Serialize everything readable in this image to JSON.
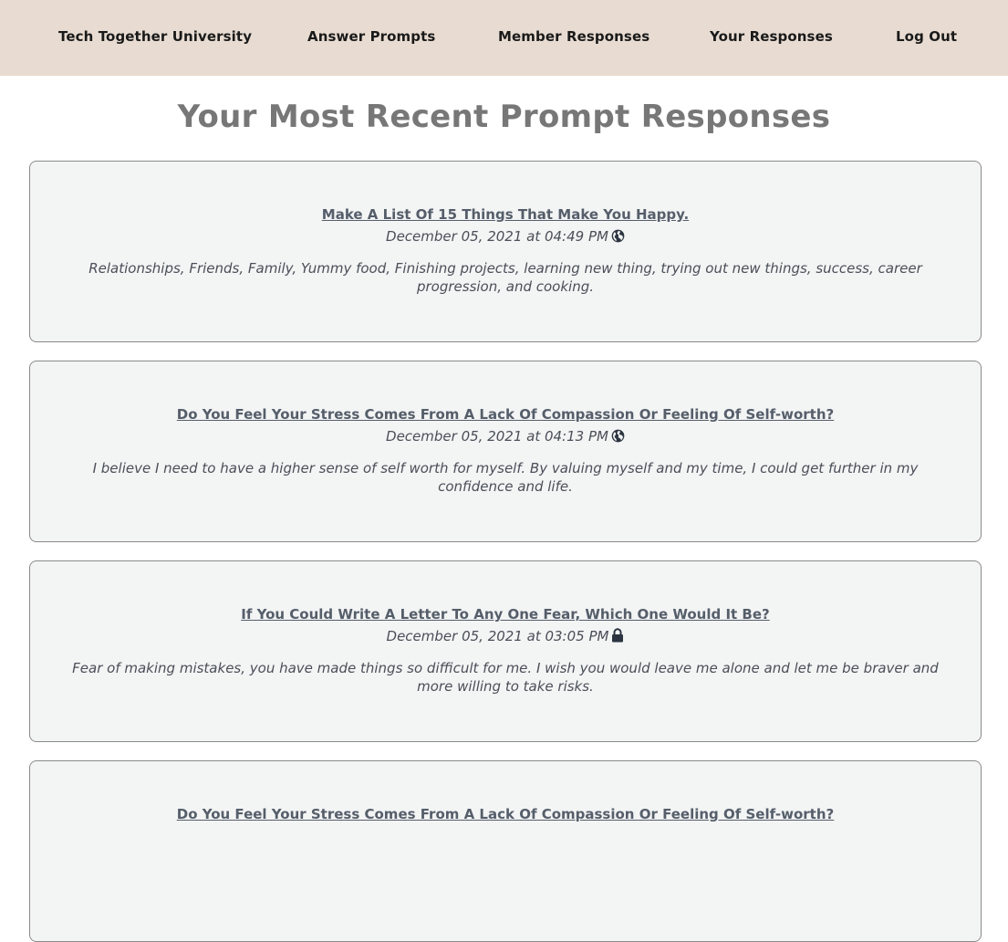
{
  "nav": {
    "items": [
      {
        "label": "Tech Together University"
      },
      {
        "label": "Answer Prompts"
      },
      {
        "label": "Member Responses"
      },
      {
        "label": "Your Responses"
      },
      {
        "label": "Log Out"
      }
    ]
  },
  "page": {
    "title": "Your Most Recent Prompt Responses"
  },
  "responses": [
    {
      "title": "Make A List Of 15 Things That Make You Happy.",
      "date": "December 05, 2021 at 04:49 PM",
      "visibility_icon": "globe-icon",
      "body": "Relationships, Friends, Family, Yummy food, Finishing projects, learning new thing, trying out new things, success, career progression, and cooking."
    },
    {
      "title": "Do You Feel Your Stress Comes From A Lack Of Compassion Or Feeling Of Self-worth?",
      "date": "December 05, 2021 at 04:13 PM",
      "visibility_icon": "globe-icon",
      "body": "I believe I need to have a higher sense of self worth for myself. By valuing myself and my time, I could get further in my confidence and life."
    },
    {
      "title": "If You Could Write A Letter To Any One Fear, Which One Would It Be?",
      "date": "December 05, 2021 at 03:05 PM",
      "visibility_icon": "lock-icon",
      "body": "Fear of making mistakes, you have made things so difficult for me. I wish you would leave me alone and let me be braver and more willing to take risks."
    },
    {
      "title": "Do You Feel Your Stress Comes From A Lack Of Compassion Or Feeling Of Self-worth?"
    }
  ],
  "colors": {
    "nav_background": "#e8dcd2",
    "card_background": "#f3f4f4",
    "title_gray": "#777777",
    "link_color": "#555e6a"
  }
}
